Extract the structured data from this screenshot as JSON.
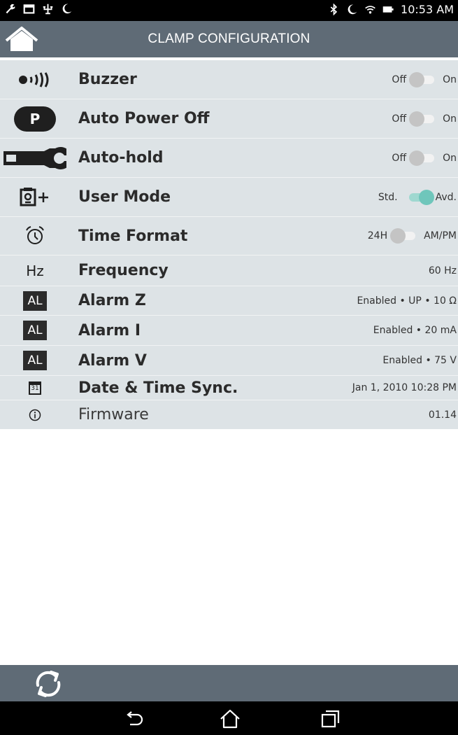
{
  "status_bar": {
    "time": "10:53 AM",
    "left_icons": [
      "wrench-icon",
      "image-icon",
      "usb-icon",
      "moon-icon"
    ],
    "right_icons": [
      "bluetooth-icon",
      "moon-icon",
      "wifi-icon",
      "battery-icon"
    ]
  },
  "header": {
    "title": "CLAMP CONFIGURATION"
  },
  "settings": {
    "buzzer": {
      "label": "Buzzer",
      "off_label": "Off",
      "on_label": "On",
      "state": "off"
    },
    "auto_power_off": {
      "label": "Auto Power Off",
      "icon_text": "P",
      "off_label": "Off",
      "on_label": "On",
      "state": "off"
    },
    "auto_hold": {
      "label": "Auto-hold",
      "off_label": "Off",
      "on_label": "On",
      "state": "off"
    },
    "user_mode": {
      "label": "User Mode",
      "off_label": "Std.",
      "on_label": "Avd.",
      "state": "on"
    },
    "time_format": {
      "label": "Time Format",
      "off_label": "24H",
      "on_label": "AM/PM",
      "state": "off"
    },
    "frequency": {
      "label": "Frequency",
      "icon_text": "Hz",
      "value": "60 Hz"
    },
    "alarm_z": {
      "label": "Alarm Z",
      "icon_text": "AL",
      "value": "Enabled • UP • 10 Ω"
    },
    "alarm_i": {
      "label": "Alarm I",
      "icon_text": "AL",
      "value": "Enabled • 20 mA"
    },
    "alarm_v": {
      "label": "Alarm V",
      "icon_text": "AL",
      "value": "Enabled • 75 V"
    },
    "date_time_sync": {
      "label": "Date & Time Sync.",
      "icon_text": "31",
      "value": "Jan 1, 2010 10:28 PM"
    },
    "firmware": {
      "label": "Firmware",
      "value": "01.14"
    }
  },
  "colors": {
    "header_bg": "#5f6b76",
    "list_bg": "#dde3e6",
    "toggle_on": "#6fc6bb",
    "toggle_off": "#c4c4c4"
  },
  "footer": {
    "refresh_icon": "refresh-icon"
  },
  "nav": {
    "buttons": [
      "back-icon",
      "home-icon",
      "recents-icon"
    ]
  }
}
